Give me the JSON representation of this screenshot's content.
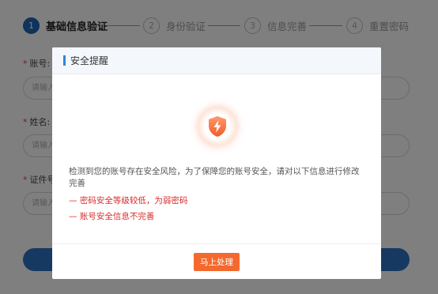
{
  "steps": [
    {
      "number": "1",
      "label": "基础信息验证",
      "active": true
    },
    {
      "number": "2",
      "label": "身份验证",
      "active": false
    },
    {
      "number": "3",
      "label": "信息完善",
      "active": false
    },
    {
      "number": "4",
      "label": "重置密码",
      "active": false
    }
  ],
  "form": {
    "required_mark": "*",
    "fields": [
      {
        "label": "账号:",
        "placeholder": "请输入"
      },
      {
        "label": "姓名:",
        "placeholder": "请输入"
      },
      {
        "label": "证件号",
        "placeholder": "请输入"
      }
    ]
  },
  "modal": {
    "title": "安全提醒",
    "icon": "shield-lightning-icon",
    "message": "检测到您的账号存在安全风险，为了保障您的账号安全，请对以下信息进行修改完善",
    "risk_items": [
      "— 密码安全等级较低，为弱密码",
      "— 账号安全信息不完善"
    ],
    "confirm_label": "马上处理"
  },
  "colors": {
    "primary": "#1d66b8",
    "warning": "#f4692e",
    "risk_text": "#d62c2c"
  }
}
